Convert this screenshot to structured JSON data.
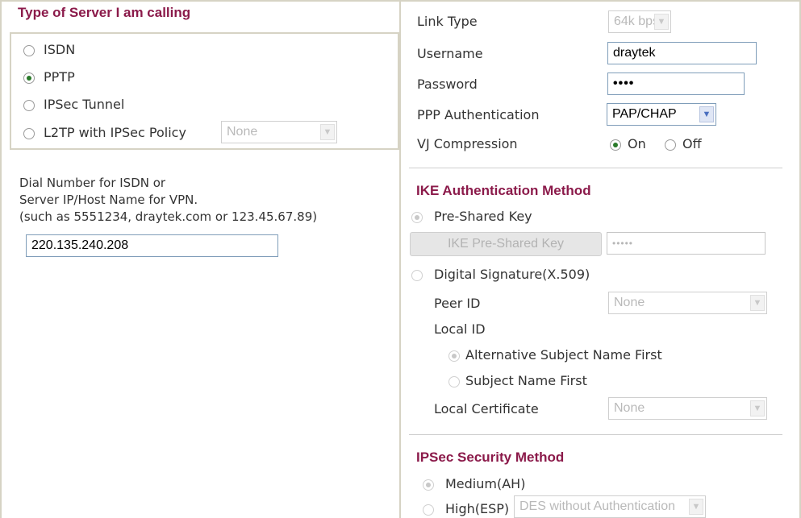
{
  "server_type": {
    "title": "Type of Server I am calling",
    "options": [
      {
        "label": "ISDN",
        "checked": false
      },
      {
        "label": "PPTP",
        "checked": true
      },
      {
        "label": "IPSec Tunnel",
        "checked": false
      },
      {
        "label": "L2TP with IPSec Policy",
        "checked": false
      }
    ],
    "l2tp_policy_select": "None"
  },
  "dial": {
    "line1": "Dial Number for ISDN or",
    "line2": "Server IP/Host Name for VPN.",
    "line3": "(such as 5551234, draytek.com or 123.45.67.89)",
    "value": "220.135.240.208"
  },
  "ppp": {
    "link_type_label": "Link Type",
    "link_type_value": "64k bps",
    "username_label": "Username",
    "username_value": "draytek",
    "password_label": "Password",
    "password_value": "••••",
    "auth_label": "PPP Authentication",
    "auth_value": "PAP/CHAP",
    "vj_label": "VJ Compression",
    "vj_on": "On",
    "vj_off": "Off",
    "vj_selected": "On"
  },
  "ike": {
    "title": "IKE Authentication Method",
    "pre_shared_label": "Pre-Shared Key",
    "pre_shared_button": "IKE Pre-Shared Key",
    "pre_shared_value": "•••••",
    "digital_signature_label": "Digital Signature(X.509)",
    "peer_id_label": "Peer ID",
    "peer_id_value": "None",
    "local_id_label": "Local ID",
    "alt_subject_label": "Alternative Subject Name First",
    "subject_label": "Subject Name First",
    "local_cert_label": "Local Certificate",
    "local_cert_value": "None"
  },
  "ipsec": {
    "title": "IPSec Security Method",
    "medium_label": "Medium(AH)",
    "high_label": "High(ESP)",
    "high_value": "DES without Authentication"
  }
}
